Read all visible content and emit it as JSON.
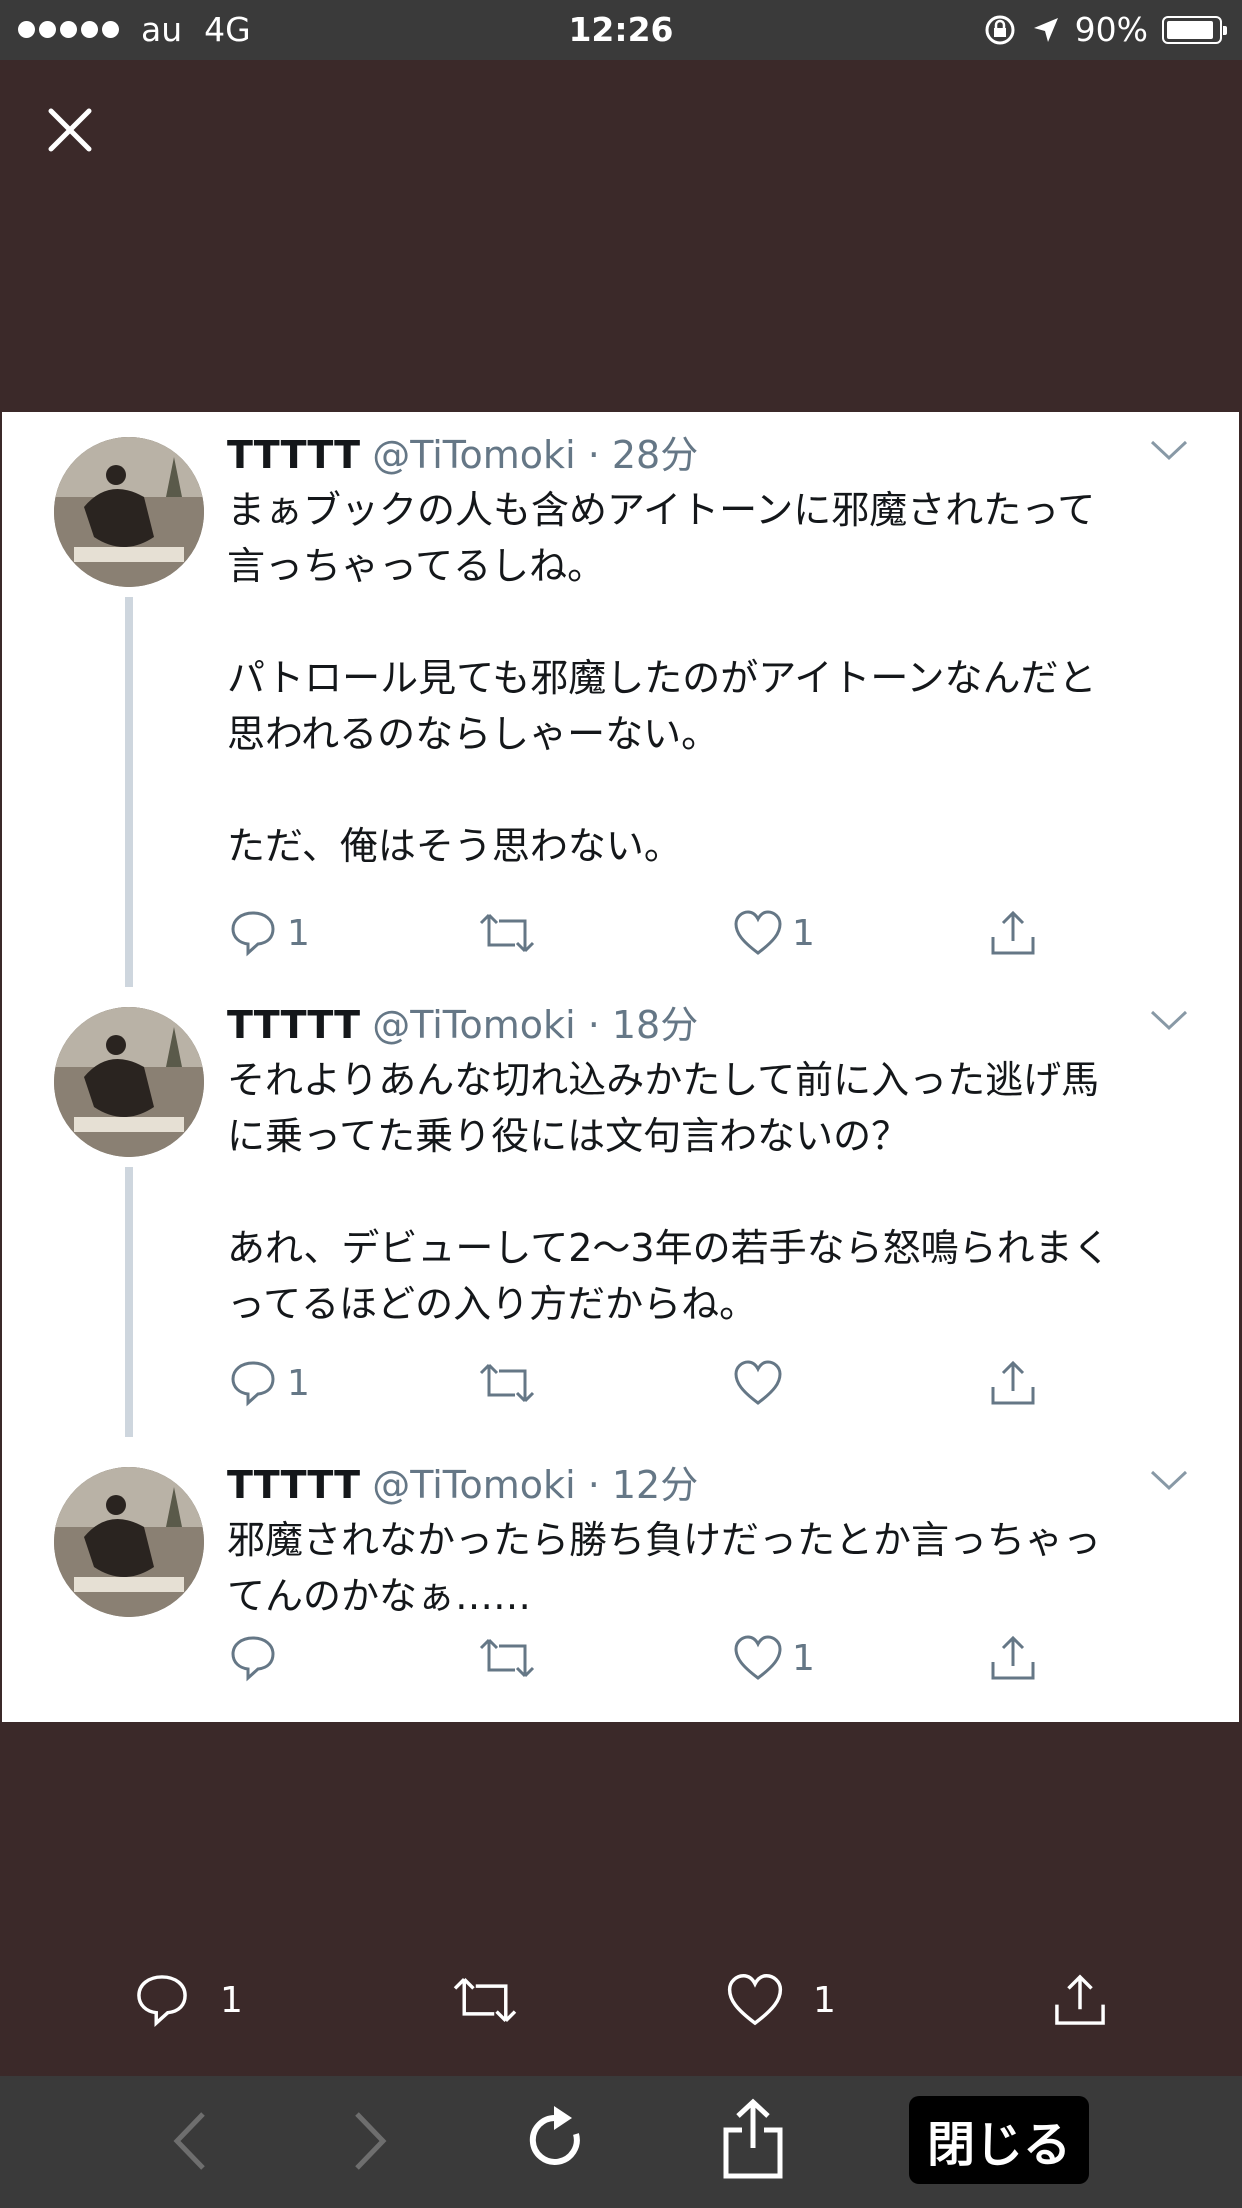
{
  "status_bar": {
    "carrier": "au",
    "network": "4G",
    "time": "12:26",
    "battery": "90%"
  },
  "tweets": [
    {
      "name": "TTTTT",
      "handle": "@TiTomoki",
      "time": "28分",
      "text": "まぁブックの人も含めアイトーンに邪魔されたって\n言っちゃってるしね。\n\nパトロール見ても邪魔したのがアイトーンなんだと\n思われるのならしゃーない。\n\nただ、俺はそう思わない。",
      "replies": "1",
      "retweets": "",
      "likes": "1"
    },
    {
      "name": "TTTTT",
      "handle": "@TiTomoki",
      "time": "18分",
      "text": "それよりあんな切れ込みかたして前に入った逃げ馬\nに乗ってた乗り役には文句言わないの？\n\nあれ、デビューして2〜3年の若手なら怒鳴られまく\nってるほどの入り方だからね。",
      "replies": "1",
      "retweets": "",
      "likes": ""
    },
    {
      "name": "TTTTT",
      "handle": "@TiTomoki",
      "time": "12分",
      "text": "邪魔されなかったら勝ち負けだったとか言っちゃっ\nてんのかなぁ……",
      "replies": "",
      "retweets": "",
      "likes": "1"
    }
  ],
  "bottom_actions": {
    "replies": "1",
    "likes": "1"
  },
  "browser_bar": {
    "close_label": "閉じる"
  },
  "colors": {
    "background": "#3b2929",
    "bar": "#3a3a3a",
    "icon_gray": "#657786"
  }
}
